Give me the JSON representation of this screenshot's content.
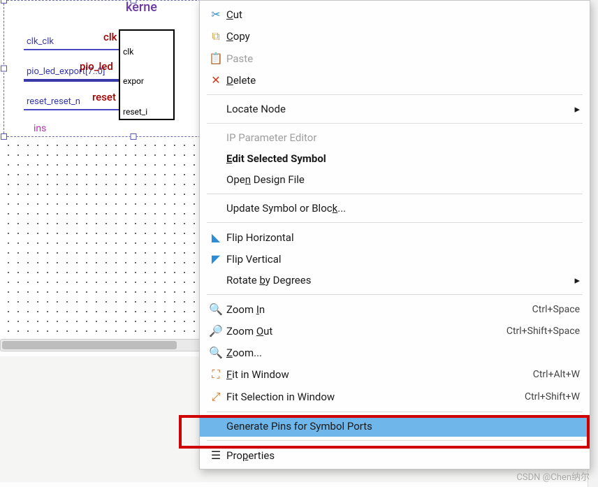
{
  "symbol": {
    "title": "kerne",
    "instance": "ins",
    "headers": {
      "clk": "clk",
      "pio": "pio_led",
      "reset": "reset"
    },
    "ports_inside": {
      "clk": "clk",
      "export": "expor",
      "reset": "reset_i"
    },
    "wires": {
      "clk": "clk_clk",
      "pio": "pio_led_export[7..0]",
      "reset": "reset_reset_n"
    }
  },
  "menu": {
    "cut": "Cut",
    "copy": "Copy",
    "paste": "Paste",
    "delete": "Delete",
    "locate": "Locate Node",
    "ip": "IP Parameter Editor",
    "edit_sym": "Edit Selected Symbol",
    "open_design": "Open Design File",
    "update_sym": "Update Symbol or Block...",
    "flip_h": "Flip Horizontal",
    "flip_v": "Flip Vertical",
    "rotate": "Rotate by Degrees",
    "zoom_in": "Zoom In",
    "zoom_out": "Zoom Out",
    "zoom": "Zoom...",
    "fit_win": "Fit in Window",
    "fit_sel": "Fit Selection in Window",
    "gen_pins": "Generate Pins for Symbol Ports",
    "props": "Properties",
    "shortcuts": {
      "zoom_in": "Ctrl+Space",
      "zoom_out": "Ctrl+Shift+Space",
      "fit_win": "Ctrl+Alt+W",
      "fit_sel": "Ctrl+Shift+W"
    }
  },
  "watermark": "CSDN @Chen纳尔"
}
